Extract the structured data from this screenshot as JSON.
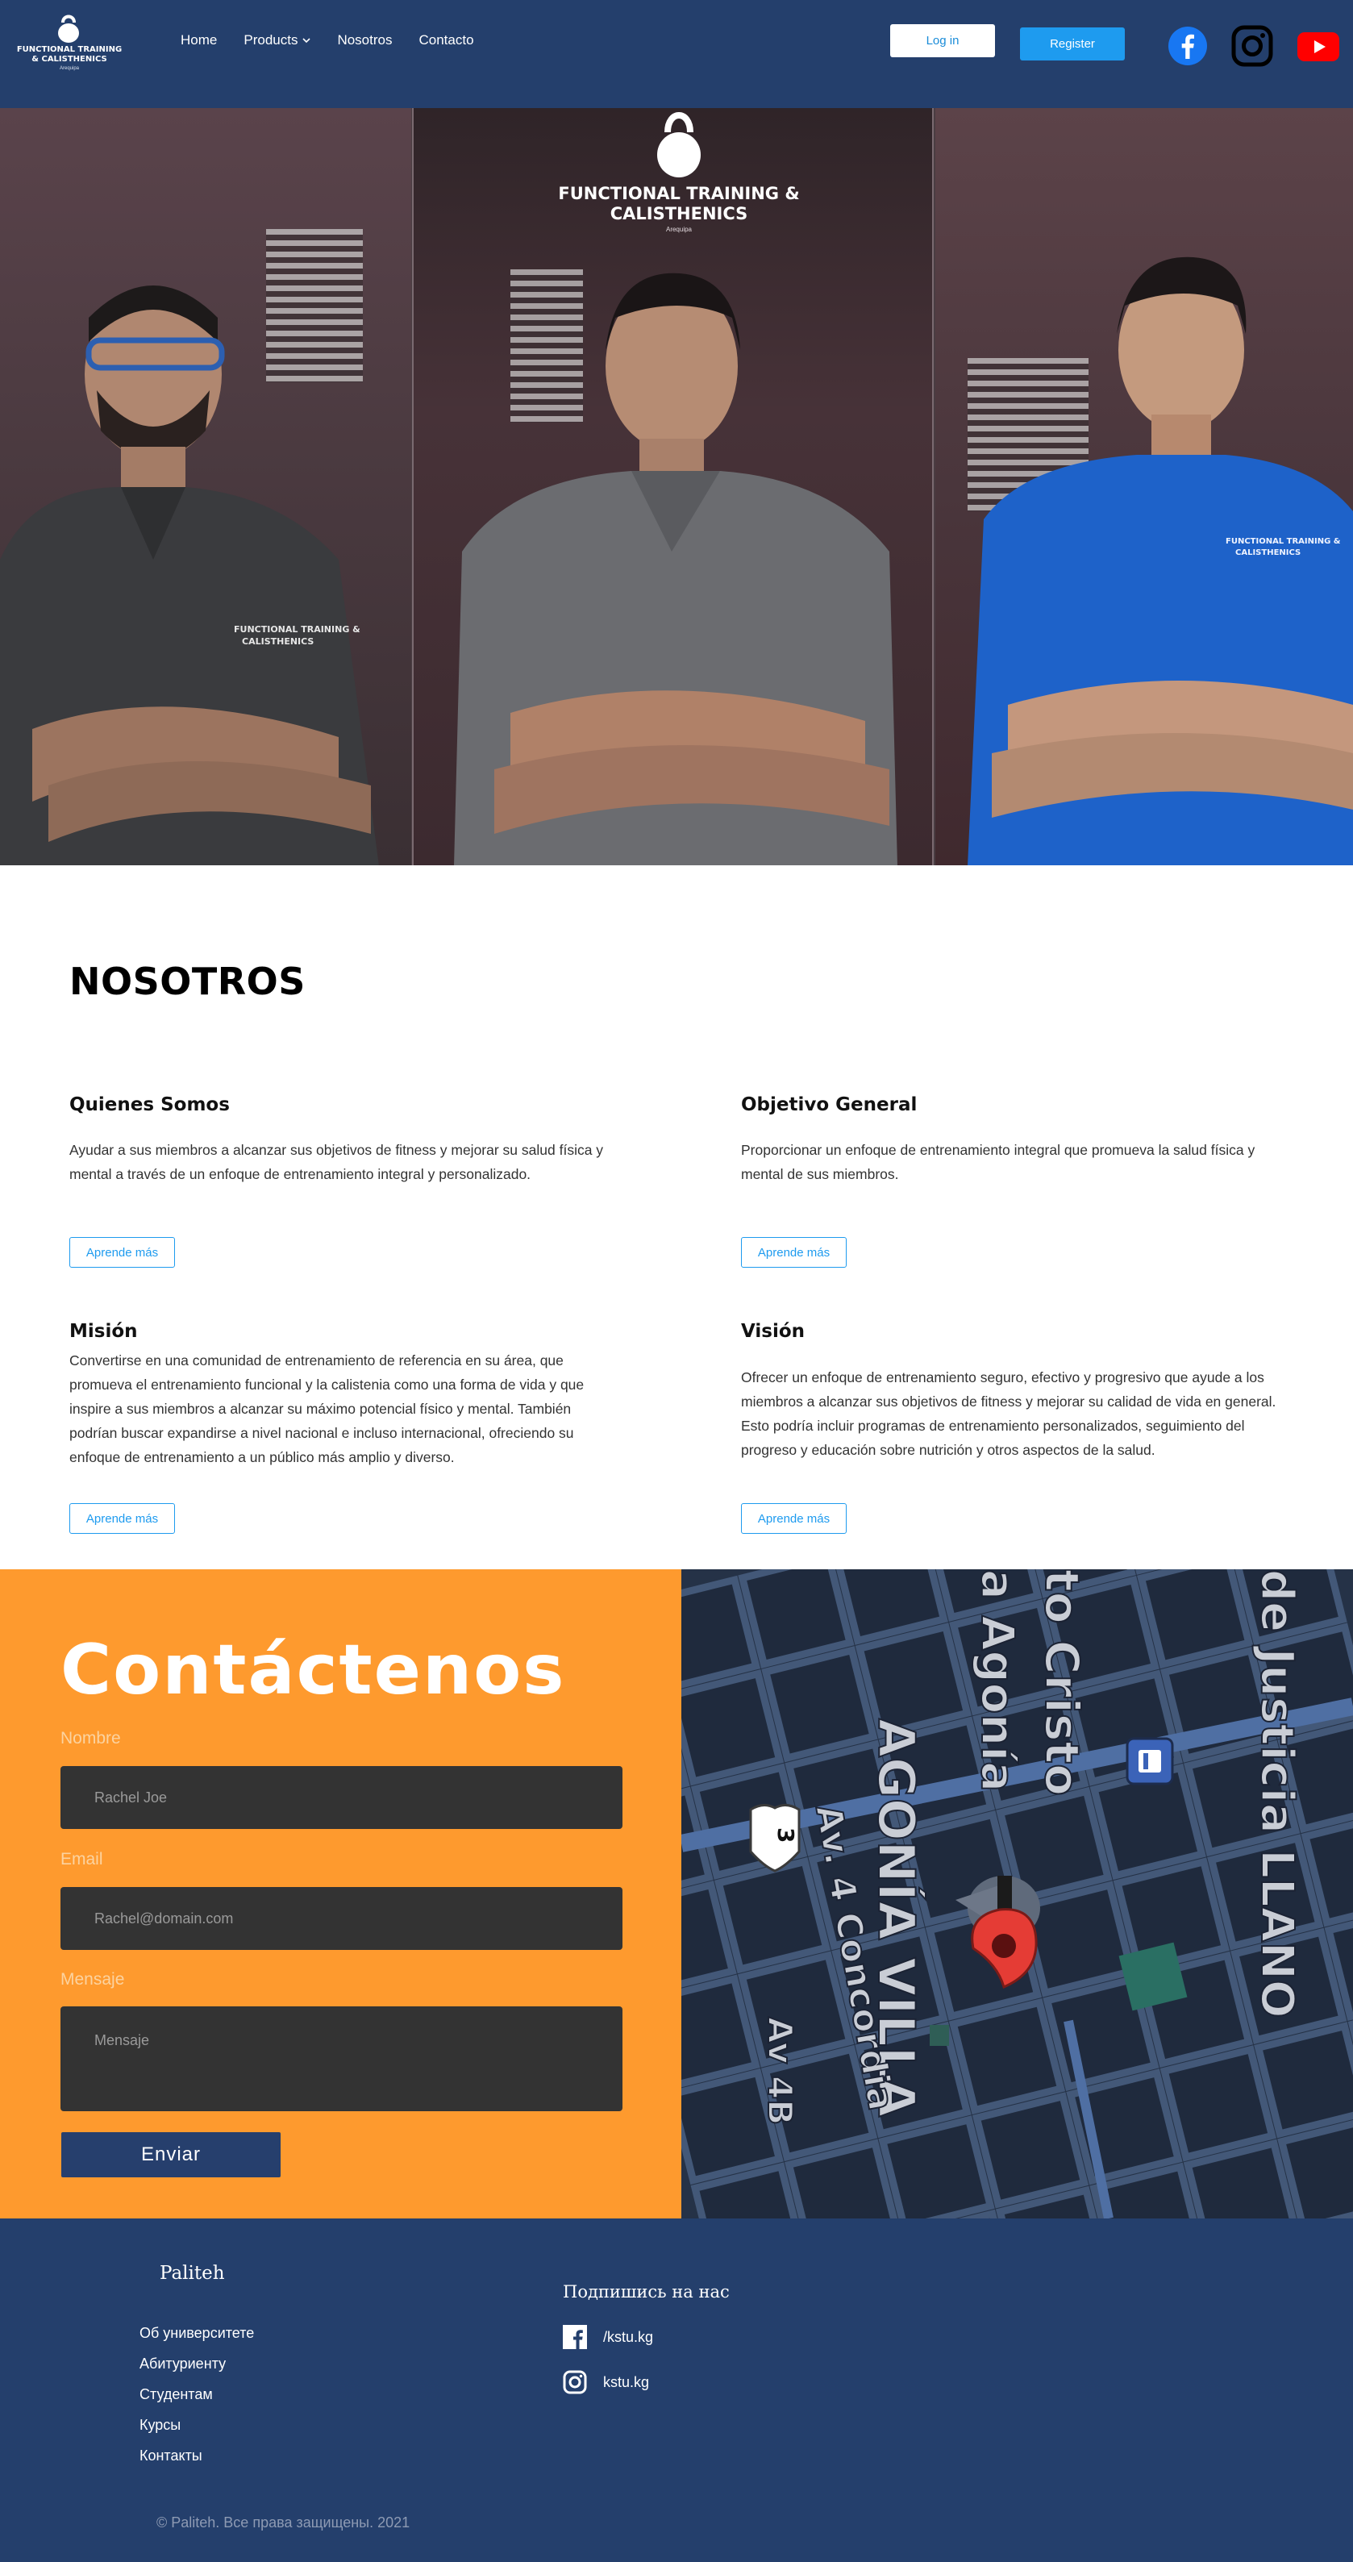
{
  "header": {
    "logo": {
      "title": "FUNCTIONAL TRAINING & CALISTHENICS",
      "subtitle": "Arequipa"
    },
    "nav": [
      {
        "label": "Home"
      },
      {
        "label": "Products",
        "has_dropdown": true
      },
      {
        "label": "Nosotros"
      },
      {
        "label": "Contacto"
      }
    ],
    "login_label": "Log in",
    "register_label": "Register",
    "social": [
      "facebook-icon",
      "instagram-icon",
      "youtube-icon"
    ]
  },
  "hero": {
    "logo_title": "FUNCTIONAL TRAINING & CALISTHENICS",
    "logo_subtitle": "Arequipa",
    "shirt_text": "FUNCTIONAL TRAINING & CALISTHENICS"
  },
  "nosotros": {
    "title": "NOSOTROS",
    "cards": [
      {
        "title": "Quienes Somos",
        "text": " Ayudar a sus miembros a alcanzar sus objetivos de fitness y mejorar su salud física y mental a través de un enfoque de entrenamiento integral y personalizado.",
        "button": "Aprende más"
      },
      {
        "title": "Objetivo General",
        "text": "Proporcionar un enfoque de entrenamiento integral que promueva la salud física y mental de sus miembros.",
        "button": "Aprende más"
      },
      {
        "title": "Misión",
        "text": "Convertirse en una comunidad de entrenamiento de referencia en su área, que promueva el entrenamiento funcional y la calistenia como una forma de vida y que inspire a sus miembros a alcanzar su máximo potencial físico y mental. También podrían buscar expandirse a nivel nacional e incluso internacional, ofreciendo su enfoque de entrenamiento a un público más amplio y diverso.",
        "button": "Aprende más"
      },
      {
        "title": "Visión",
        "text": "Ofrecer un enfoque de entrenamiento seguro, efectivo y progresivo que ayude a los miembros a alcanzar sus objetivos de fitness y mejorar su calidad de vida en general. Esto podría incluir programas de entrenamiento personalizados, seguimiento del progreso y educación sobre nutrición y otros aspectos de la salud.",
        "button": "Aprende más"
      }
    ]
  },
  "contact": {
    "title": "Contáctenos",
    "name_label": "Nombre",
    "name_placeholder": "Rachel Joe",
    "email_label": "Email",
    "email_placeholder": "Rachel@domain.com",
    "message_label": "Mensaje",
    "message_placeholder": "Mensaje",
    "send_label": "Enviar"
  },
  "map": {
    "labels": [
      "de Justicia LLANO",
      "to Cristo",
      "a Agonía",
      "AGONÍA VILLA",
      "Av. 4 Concordia",
      "Av 4B",
      "3"
    ]
  },
  "footer": {
    "brand": "Paliteh",
    "links": [
      "Об университете",
      "Абитуриенту",
      "Студентам",
      "Курсы",
      "Контакты"
    ],
    "follow_title": "Подпишись на нас",
    "social": [
      {
        "icon": "facebook-icon",
        "label": "/kstu.kg"
      },
      {
        "icon": "instagram-icon",
        "label": "kstu.kg"
      }
    ],
    "copyright": "© Paliteh. Все права защищены. 2021"
  },
  "colors": {
    "header_bg": "#243f6c",
    "accent_blue": "#1e9bef",
    "contact_bg": "#fe9a2e",
    "field_bg": "#333333",
    "send_button": "#263f6d",
    "footer_bg": "#243f6c"
  }
}
